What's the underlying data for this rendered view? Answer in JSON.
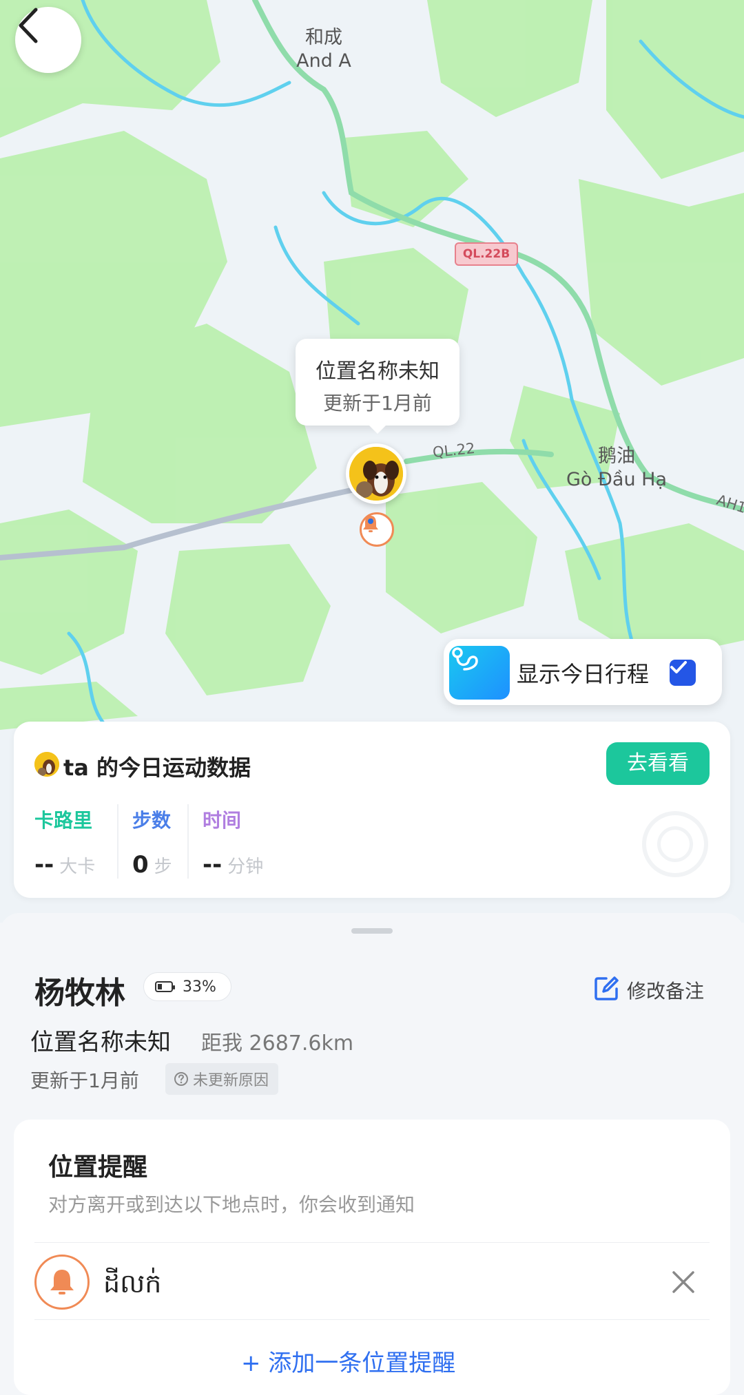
{
  "map": {
    "labels": {
      "town_1_cn": "和成",
      "town_1_en": "And A",
      "town_2_cn": "鹅油",
      "town_2_en": "Gò Đầu Hạ",
      "road_shield": "QL.22B",
      "road_1": "QL.22",
      "road_2": "AH1"
    },
    "bubble": {
      "title": "位置名称未知",
      "subtitle": "更新于1月前"
    },
    "trip_toggle": {
      "label": "显示今日行程",
      "checked": true
    },
    "icons": {
      "back": "chevron-left-icon",
      "route": "route-icon",
      "bell": "bell-icon",
      "check": "check-icon"
    }
  },
  "sport": {
    "title": "ta 的今日运动数据",
    "go_button": "去看看",
    "stats": [
      {
        "label": "卡路里",
        "value": "--",
        "unit": "大卡",
        "color": "#1cc79c"
      },
      {
        "label": "步数",
        "value": "0",
        "unit": "步",
        "color": "#4a7ee8"
      },
      {
        "label": "时间",
        "value": "--",
        "unit": "分钟",
        "color": "#b07ee0"
      }
    ]
  },
  "profile": {
    "name": "杨牧林",
    "battery": "33%",
    "edit_remark": "修改备注",
    "location_name": "位置名称未知",
    "distance": "距我 2687.6km",
    "updated": "更新于1月前",
    "not_updated_reason": "未更新原因"
  },
  "alerts": {
    "title": "位置提醒",
    "subtitle": "对方离开或到达以下地点时，你会收到通知",
    "items": [
      {
        "name": "ដីលក់"
      }
    ],
    "add_label": "+ 添加一条位置提醒"
  },
  "colors": {
    "accent_green": "#1cc79c",
    "accent_blue": "#2456e6",
    "alert_orange": "#f08a55",
    "map_green": "#b9f0ac",
    "river": "#5fd0ee",
    "highway": "#8fdcaa"
  }
}
